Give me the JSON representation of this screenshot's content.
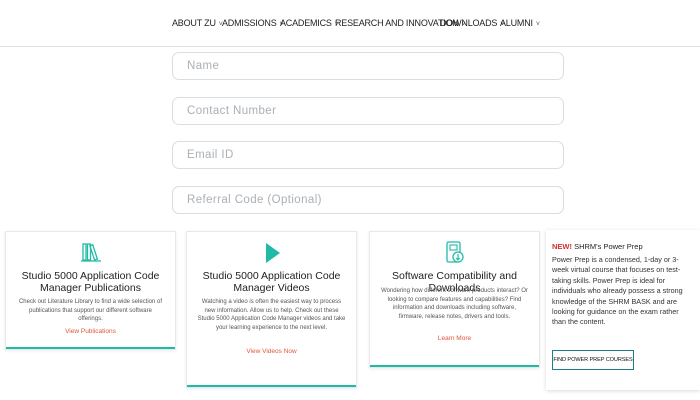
{
  "nav": {
    "items": [
      {
        "label": "ABOUT ZU"
      },
      {
        "label": "ADMISSIONS"
      },
      {
        "label": "ACADEMICS"
      },
      {
        "label": "RESEARCH AND INNOVATION"
      },
      {
        "label": "DOWNLOADS"
      },
      {
        "label": "ALUMNI"
      }
    ],
    "chevron": "˅"
  },
  "form": {
    "name_placeholder": "Name",
    "contact_placeholder": "Contact Number",
    "email_placeholder": "Email ID",
    "referral_placeholder": "Referral Code (Optional)"
  },
  "cards": [
    {
      "icon": "books-icon",
      "title": "Studio 5000 Application Code Manager Publications",
      "text": "Check out Literature Library to find a wide selection of publications that support our different software offerings.",
      "link": "View Publications"
    },
    {
      "icon": "play-icon",
      "title": "Studio 5000 Application Code Manager Videos",
      "text": "Watching a video is often the easiest way to process new information. Allow us to help. Check out these Studio 5000 Application Code Manager videos and take your learning experience to the next level.",
      "link": "View Videos Now"
    },
    {
      "icon": "download-icon",
      "title": "Software Compatibility and Downloads",
      "text": "Wondering how different software products interact? Or looking to compare features and capabilities? Find information and downloads including software, firmware, release notes, drivers and tools.",
      "link": "Learn More"
    }
  ],
  "promo": {
    "new_label": "NEW!",
    "title": "SHRM's Power Prep",
    "text": "Power Prep is a condensed, 1-day or 3-week virtual course that focuses on test-taking skills. Power Prep is ideal for individuals who already possess a strong knowledge of the SHRM BASK and are looking for guidance on the exam rather than the content.",
    "button": "FIND POWER PREP COURSES"
  },
  "colors": {
    "accent": "#1fbba6",
    "link": "#e0573a",
    "new": "#d32f2f"
  }
}
